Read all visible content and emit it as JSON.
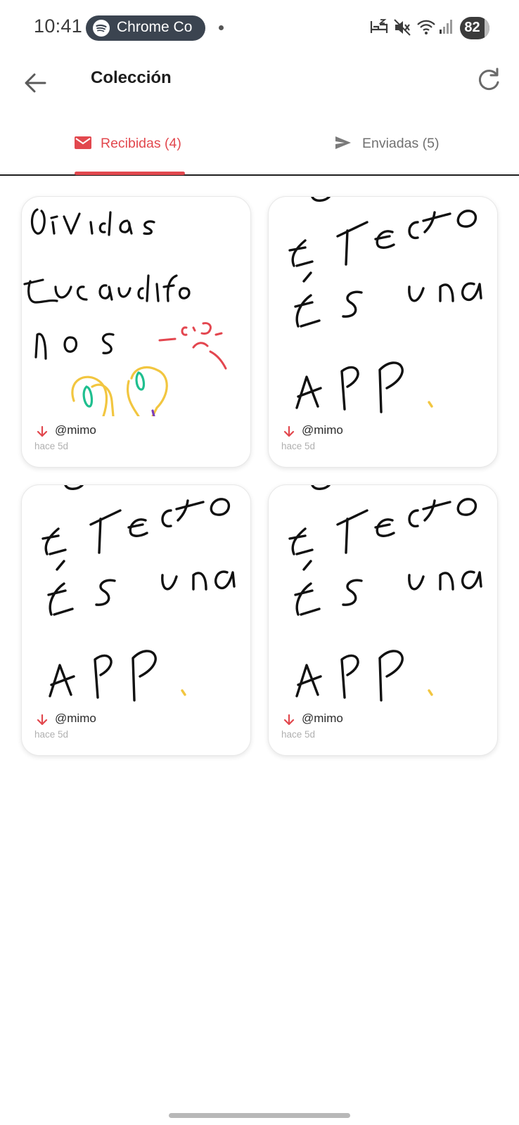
{
  "status_bar": {
    "time": "10:41",
    "media_pill": "Chrome Co",
    "battery": "82",
    "icons": [
      "spotify-icon",
      "sleep-icon",
      "mute-icon",
      "wifi-icon",
      "signal-icon",
      "battery-icon"
    ]
  },
  "app_bar": {
    "title": "Colección",
    "back_icon": "arrow-left-icon",
    "refresh_icon": "refresh-icon"
  },
  "tabs": [
    {
      "label": "Recibidas (4)",
      "icon": "envelope-icon",
      "active": true
    },
    {
      "label": "Enviadas (5)",
      "icon": "send-icon",
      "active": false
    }
  ],
  "colors": {
    "accent": "#e2484e",
    "ink": "#111111",
    "drawing_red": "#e3464f",
    "drawing_yellow": "#f2c640",
    "drawing_green": "#1fbf8f",
    "drawing_purple": "#7b3fb8"
  },
  "cards": [
    {
      "user": "@mimo",
      "time": "hace 5d",
      "drawing": "olvidas",
      "direction_icon": "arrow-down-icon"
    },
    {
      "user": "@mimo",
      "time": "hace 5d",
      "drawing": "efecto",
      "direction_icon": "arrow-down-icon"
    },
    {
      "user": "@mimo",
      "time": "hace 5d",
      "drawing": "efecto",
      "direction_icon": "arrow-down-icon"
    },
    {
      "user": "@mimo",
      "time": "hace 5d",
      "drawing": "efecto",
      "direction_icon": "arrow-down-icon"
    }
  ]
}
